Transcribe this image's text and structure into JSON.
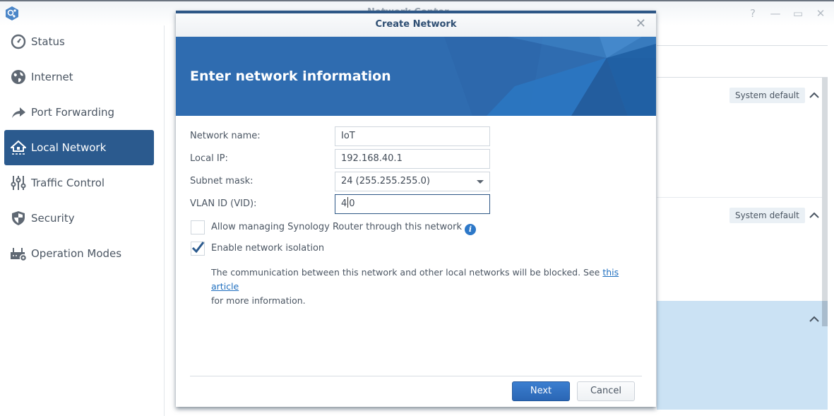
{
  "window": {
    "title": "Network Center",
    "controls": [
      "help",
      "minimize",
      "maximize",
      "close"
    ]
  },
  "sidebar": {
    "items": [
      {
        "label": "Status",
        "icon": "speedometer-icon",
        "active": false
      },
      {
        "label": "Internet",
        "icon": "globe-icon",
        "active": false
      },
      {
        "label": "Port Forwarding",
        "icon": "forward-arrow-icon",
        "active": false
      },
      {
        "label": "Local Network",
        "icon": "home-network-icon",
        "active": true
      },
      {
        "label": "Traffic Control",
        "icon": "sliders-icon",
        "active": false
      },
      {
        "label": "Security",
        "icon": "shield-icon",
        "active": false
      },
      {
        "label": "Operation Modes",
        "icon": "router-gear-icon",
        "active": false
      }
    ]
  },
  "background_panel": {
    "sections": [
      {
        "badge": "System default",
        "expanded": true,
        "selected": false
      },
      {
        "badge": "System default",
        "expanded": true,
        "selected": false
      },
      {
        "badge": "",
        "expanded": true,
        "selected": true
      }
    ]
  },
  "dialog": {
    "title": "Create Network",
    "banner_title": "Enter network information",
    "fields": {
      "network_name": {
        "label": "Network name:",
        "value": "IoT"
      },
      "local_ip": {
        "label": "Local IP:",
        "value": "192.168.40.1"
      },
      "subnet_mask": {
        "label": "Subnet mask:",
        "value": "24 (255.255.255.0)"
      },
      "vlan_id": {
        "label": "VLAN ID (VID):",
        "value_before_caret": "4",
        "value_after_caret": "0"
      }
    },
    "options": {
      "allow_managing": {
        "label": "Allow managing Synology Router through this network",
        "checked": false
      },
      "isolation": {
        "label": "Enable network isolation",
        "checked": true
      }
    },
    "description": {
      "text": "The communication between this network and other local networks will be blocked. See ",
      "link": "this article",
      "suffix": "for more information."
    },
    "buttons": {
      "next": "Next",
      "cancel": "Cancel"
    }
  },
  "colors": {
    "accent": "#2b5a8e",
    "primary_button": "#2e6fbf",
    "banner": "#2f6cb0",
    "selected_section": "#cbe2f4",
    "link": "#1f6fbf"
  }
}
